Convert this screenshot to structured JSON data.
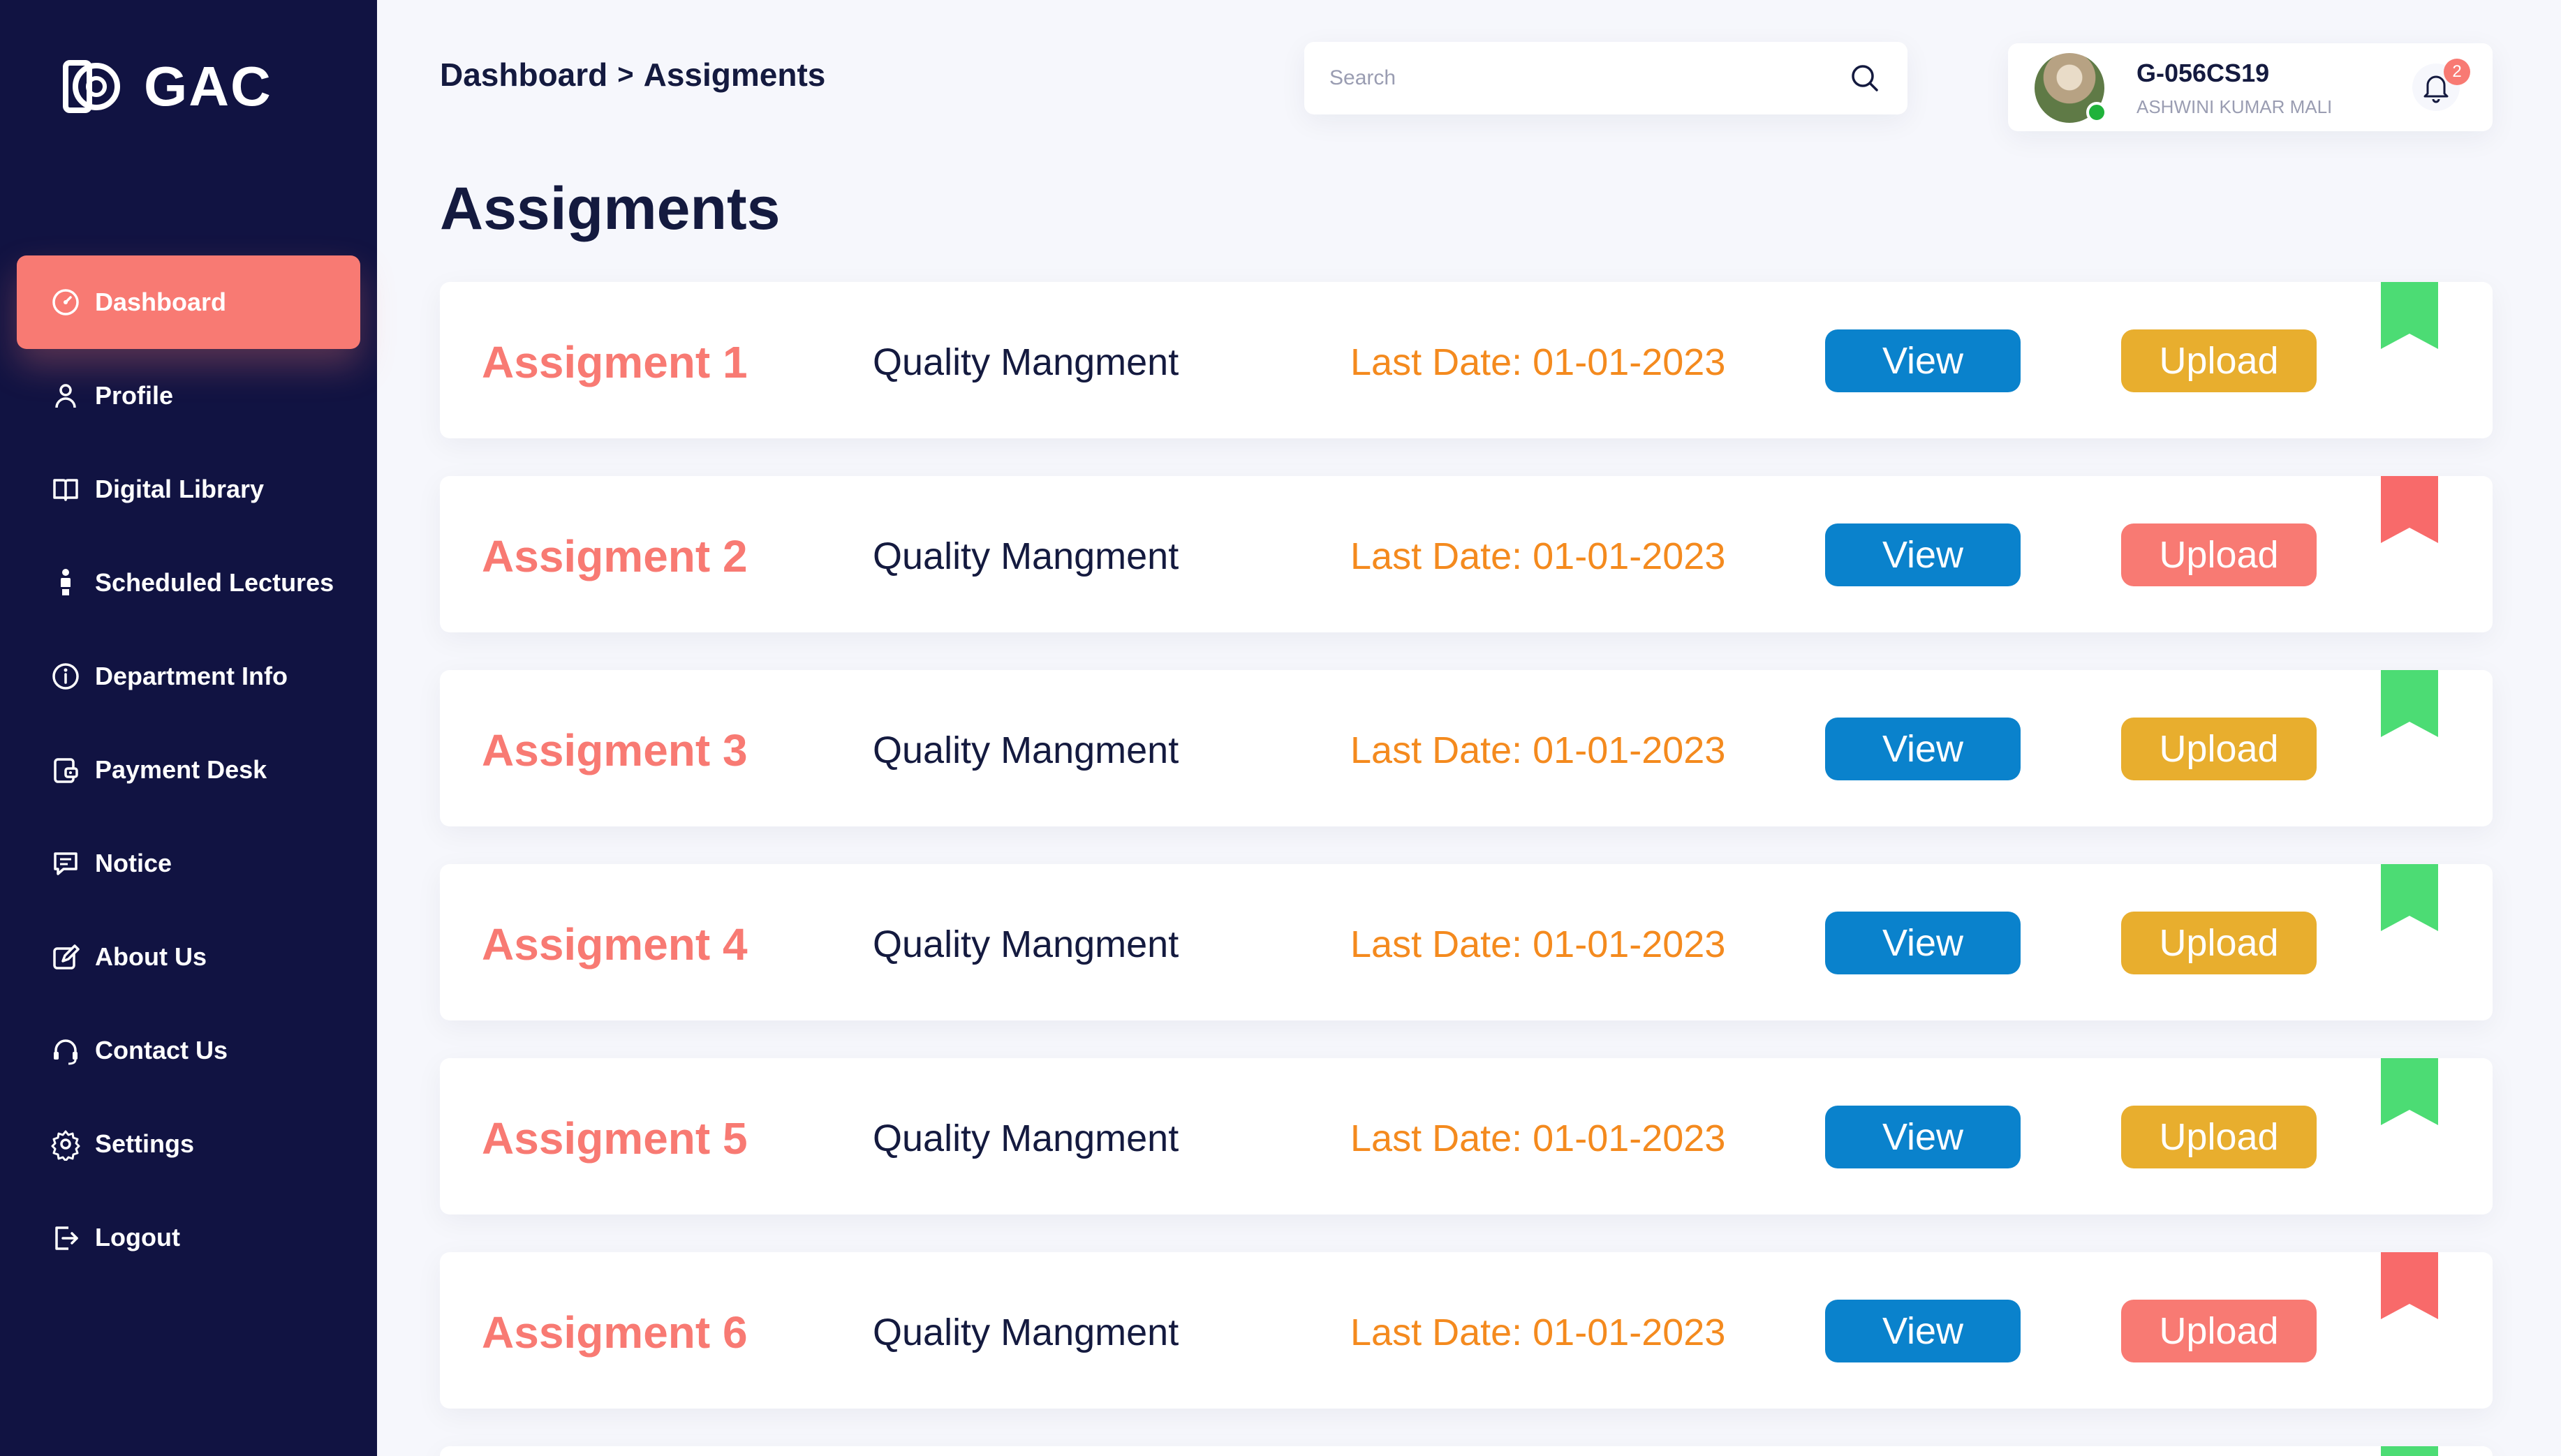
{
  "app": {
    "logo_text": "GAC"
  },
  "sidebar": {
    "items": [
      {
        "label": "Dashboard",
        "icon": "dashboard-gauge-icon",
        "active": true
      },
      {
        "label": "Profile",
        "icon": "user-icon"
      },
      {
        "label": "Digital Library",
        "icon": "book-icon"
      },
      {
        "label": "Scheduled Lectures",
        "icon": "lecturer-icon"
      },
      {
        "label": "Department Info",
        "icon": "info-icon"
      },
      {
        "label": "Payment Desk",
        "icon": "payment-icon"
      },
      {
        "label": "Notice",
        "icon": "message-icon"
      },
      {
        "label": "About Us",
        "icon": "edit-icon"
      },
      {
        "label": "Contact Us",
        "icon": "headset-icon"
      },
      {
        "label": "Settings",
        "icon": "gear-icon"
      },
      {
        "label": "Logout",
        "icon": "logout-icon"
      }
    ]
  },
  "header": {
    "breadcrumb": {
      "root": "Dashboard",
      "separator": ">",
      "current": "Assigments"
    },
    "search": {
      "placeholder": "Search",
      "value": ""
    },
    "user": {
      "id": "G-056CS19",
      "name": "ASHWINI KUMAR MALI",
      "notifications": "2",
      "online": true
    }
  },
  "main": {
    "title": "Assigments",
    "assignments": [
      {
        "name": "Assigment 1",
        "subject": "Quality Mangment",
        "due": "Last Date: 01-01-2023",
        "view_label": "View",
        "upload_label": "Upload",
        "status": "done"
      },
      {
        "name": "Assigment 2",
        "subject": "Quality Mangment",
        "due": "Last Date: 01-01-2023",
        "view_label": "View",
        "upload_label": "Upload",
        "status": "pending"
      },
      {
        "name": "Assigment 3",
        "subject": "Quality Mangment",
        "due": "Last Date: 01-01-2023",
        "view_label": "View",
        "upload_label": "Upload",
        "status": "done"
      },
      {
        "name": "Assigment 4",
        "subject": "Quality Mangment",
        "due": "Last Date: 01-01-2023",
        "view_label": "View",
        "upload_label": "Upload",
        "status": "done"
      },
      {
        "name": "Assigment 5",
        "subject": "Quality Mangment",
        "due": "Last Date: 01-01-2023",
        "view_label": "View",
        "upload_label": "Upload",
        "status": "done"
      },
      {
        "name": "Assigment 6",
        "subject": "Quality Mangment",
        "due": "Last Date: 01-01-2023",
        "view_label": "View",
        "upload_label": "Upload",
        "status": "pending"
      }
    ],
    "partial_next_status": "done"
  },
  "colors": {
    "sidebar_bg": "#111342",
    "accent_coral": "#f87a73",
    "view_blue": "#0a82cc",
    "upload_yellow": "#e8ae2e",
    "due_orange": "#f48a1e",
    "ribbon_green": "#4cdc74",
    "ribbon_red": "#f86a6a"
  }
}
